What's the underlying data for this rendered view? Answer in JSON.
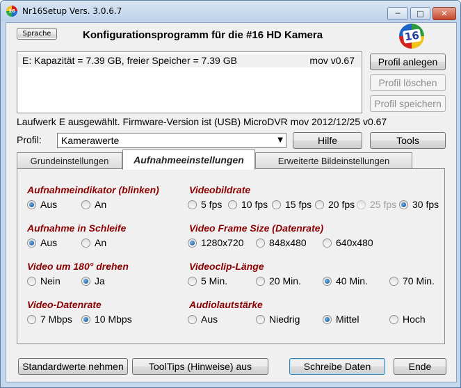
{
  "window": {
    "title": "Nr16Setup  Vers. 3.0.6.7",
    "app_icon_text": "16",
    "minimize": "─",
    "maximize": "□",
    "close": "✕"
  },
  "header": {
    "language_button": "Sprache",
    "heading": "Konfigurationsprogramm für die #16 HD Kamera",
    "logo_text": "16"
  },
  "drive_list": {
    "drive_entry": "E:  Kapazität = 7.39 GB, freier Speicher = 7.39 GB",
    "version": "mov v0.67"
  },
  "profile_buttons": {
    "create": "Profil anlegen",
    "delete": "Profil löschen",
    "save": "Profil speichern"
  },
  "status_line": "Laufwerk E ausgewählt. Firmware-Version ist (USB) MicroDVR mov 2012/12/25 v0.67",
  "profile": {
    "label": "Profil:",
    "value": "Kamerawerte",
    "help_button": "Hilfe",
    "tools_button": "Tools"
  },
  "tabs": [
    "Grundeinstellungen",
    "Aufnahmeeinstellungen",
    "Erweiterte Bildeinstellungen"
  ],
  "active_tab": "Aufnahmeeinstellungen",
  "groups": {
    "indicator": {
      "label": "Aufnahmeindikator (blinken)",
      "options": [
        "Aus",
        "An"
      ],
      "selected": "Aus"
    },
    "loop": {
      "label": "Aufnahme in Schleife",
      "options": [
        "Aus",
        "An"
      ],
      "selected": "Aus"
    },
    "rotate": {
      "label": "Video um 180° drehen",
      "options": [
        "Nein",
        "Ja"
      ],
      "selected": "Ja"
    },
    "datarate": {
      "label": "Video-Datenrate",
      "options": [
        "7 Mbps",
        "10 Mbps"
      ],
      "selected": "10 Mbps"
    },
    "framerate": {
      "label": "Videobildrate",
      "options": [
        "5 fps",
        "10 fps",
        "15 fps",
        "20 fps",
        "25 fps",
        "30 fps"
      ],
      "selected": "30 fps",
      "disabled": [
        "25 fps"
      ]
    },
    "framesize": {
      "label": "Video Frame Size (Datenrate)",
      "options": [
        "1280x720",
        "848x480",
        "640x480"
      ],
      "selected": "1280x720"
    },
    "cliplength": {
      "label": "Videoclip-Länge",
      "options": [
        "5 Min.",
        "20 Min.",
        "40 Min.",
        "70 Min."
      ],
      "selected": "40 Min."
    },
    "audio": {
      "label": "Audiolautstärke",
      "options": [
        "Aus",
        "Niedrig",
        "Mittel",
        "Hoch"
      ],
      "selected": "Mittel"
    }
  },
  "footer": {
    "defaults": "Standardwerte nehmen",
    "tooltips": "ToolTips (Hinweise) aus",
    "write": "Schreibe Daten",
    "end": "Ende"
  },
  "colors": {
    "group_label": "#8b0000",
    "title_bar": "#c4d7ec",
    "window_bg": "#f0f0f0"
  }
}
